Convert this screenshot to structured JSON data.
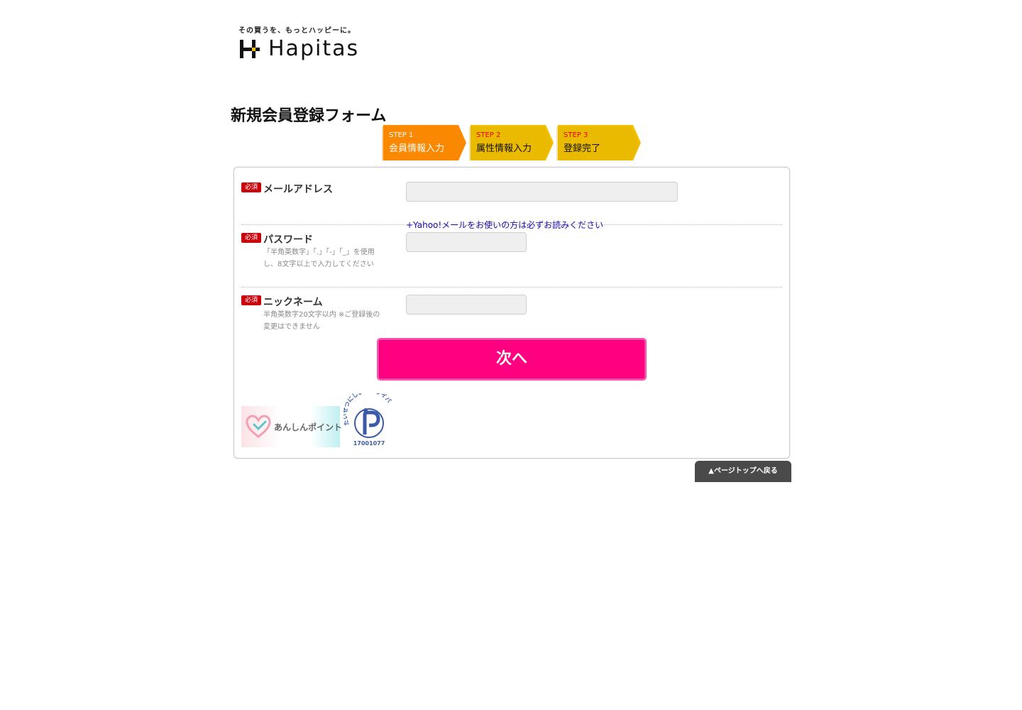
{
  "header": {
    "tagline": "その買うを、もっとハッピーに。",
    "logo_text": "Hapitas"
  },
  "page_title": "新規会員登録フォーム",
  "steps": [
    {
      "label": "STEP 1",
      "name": "会員情報入力",
      "active": true
    },
    {
      "label": "STEP 2",
      "name": "属性情報入力",
      "active": false
    },
    {
      "label": "STEP 3",
      "name": "登録完了",
      "active": false
    }
  ],
  "form": {
    "required_badge": "必須",
    "email": {
      "label": "メールアドレス",
      "value": "",
      "yahoo_note": "+Yahoo!メールをお使いの方は必ずお読みください"
    },
    "password": {
      "label": "パスワード",
      "hint": "「半角英数字」「.」「-」「_」を使用し、8文字以上で入力してください",
      "value": ""
    },
    "nickname": {
      "label": "ニックネーム",
      "hint": "半角英数字20文字以内 ※ご登録後の変更はできません",
      "value": ""
    },
    "next_button": "次へ"
  },
  "badges": {
    "anshin": "あんしんポイント",
    "privacy_arc": "たいせつにしますプライバシー",
    "privacy_number": "17001077"
  },
  "page_top": "▲ページトップへ戻る",
  "colors": {
    "step_active": "#ff8c00",
    "step_inactive": "#f2c200",
    "next_button": "#ff0080",
    "required": "#c8000a",
    "link": "#1a0dab"
  }
}
